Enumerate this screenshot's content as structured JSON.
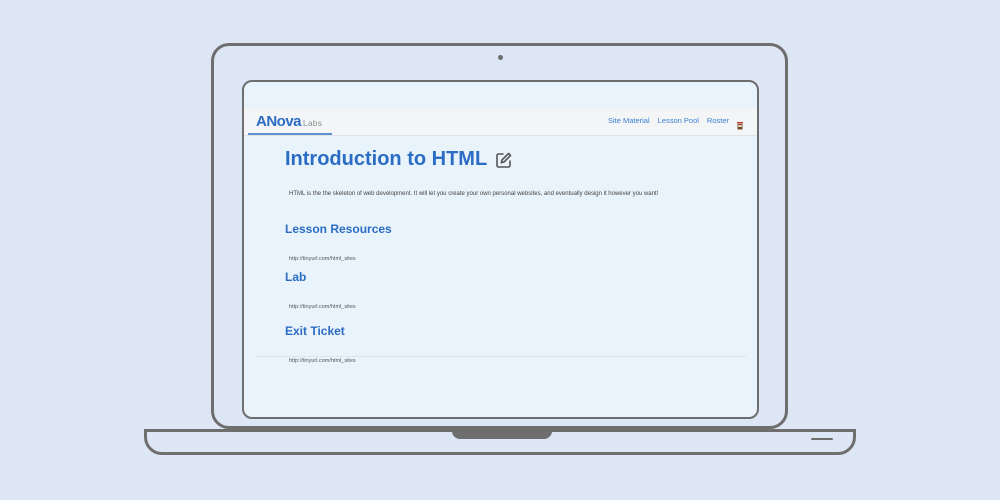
{
  "navbar": {
    "brand_main": "ANova",
    "brand_sub": "Labs",
    "links": [
      "Site Material",
      "Lesson Pool",
      "Roster"
    ]
  },
  "page": {
    "title": "Introduction to HTML",
    "intro": "HTML is the the skeleton of web development. It will let you create your own personal websites, and eventually design it however you want!"
  },
  "sections": [
    {
      "title": "Lesson Resources",
      "link": "http://tinyurl.com/html_sites"
    },
    {
      "title": "Lab",
      "link": "http://tinyurl.com/html_sites"
    },
    {
      "title": "Exit Ticket",
      "link": "http://tinyurl.com/html_sites"
    }
  ],
  "colors": {
    "accent": "#2b6cc4",
    "background": "#dde6f5",
    "screen": "#e9f3fb"
  },
  "icons": [
    "cup-icon",
    "edit-icon"
  ]
}
